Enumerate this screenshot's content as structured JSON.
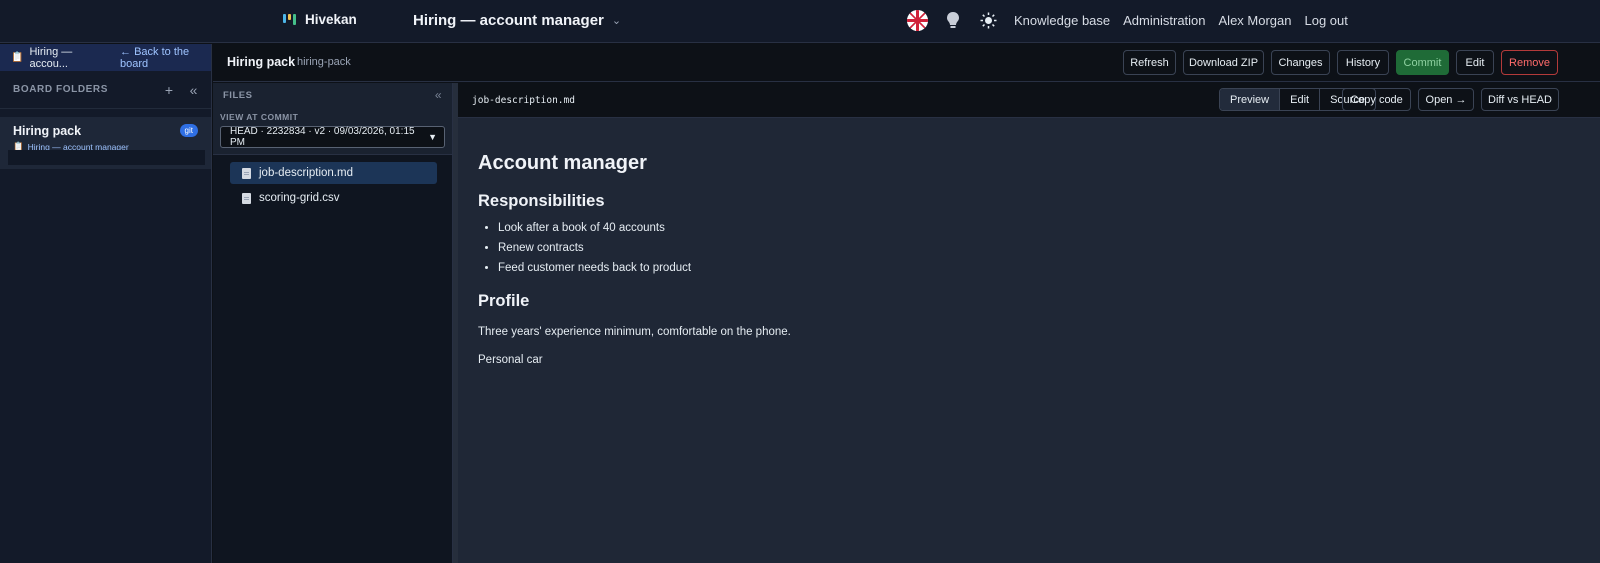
{
  "app": {
    "name": "Hivekan"
  },
  "board": {
    "title": "Hiring — account manager"
  },
  "topnav": {
    "knowledge": "Knowledge base",
    "admin": "Administration",
    "user": "Alex Morgan",
    "logout": "Log out"
  },
  "sidebar": {
    "crumb": "Hiring — accou...",
    "back": "← Back to the board",
    "heading": "BOARD FOLDERS",
    "add": "+",
    "collapse": "«",
    "folder": {
      "name": "Hiring pack",
      "sub": "Hiring — account manager",
      "badge": "git"
    }
  },
  "header": {
    "title": "Hiring pack",
    "slug": "hiring-pack",
    "buttons": {
      "refresh": "Refresh",
      "zip": "Download ZIP",
      "changes": "Changes",
      "history": "History",
      "commit": "Commit",
      "edit": "Edit",
      "remove": "Remove"
    }
  },
  "files": {
    "heading": "FILES",
    "collapse": "«",
    "commit_label": "VIEW AT COMMIT",
    "commit_value": "HEAD · 2232834 · v2 · 09/03/2026, 01:15 PM",
    "items": [
      "job-description.md",
      "scoring-grid.csv"
    ]
  },
  "viewer": {
    "filename": "job-description.md",
    "modes": [
      "Preview",
      "Edit",
      "Source"
    ],
    "copy": "Copy code",
    "open": "Open →",
    "diff": "Diff vs HEAD"
  },
  "doc": {
    "h1": "Account manager",
    "h2a": "Responsibilities",
    "bullets": [
      "Look after a book of 40 accounts",
      "Renew contracts",
      "Feed customer needs back to product"
    ],
    "h2b": "Profile",
    "p1": "Three years' experience minimum, comfortable on the phone.",
    "p2": "Personal car"
  },
  "colors": {
    "accent": "#2f6fe4",
    "commit": "#1f6b37",
    "danger": "#ff6b6b"
  }
}
